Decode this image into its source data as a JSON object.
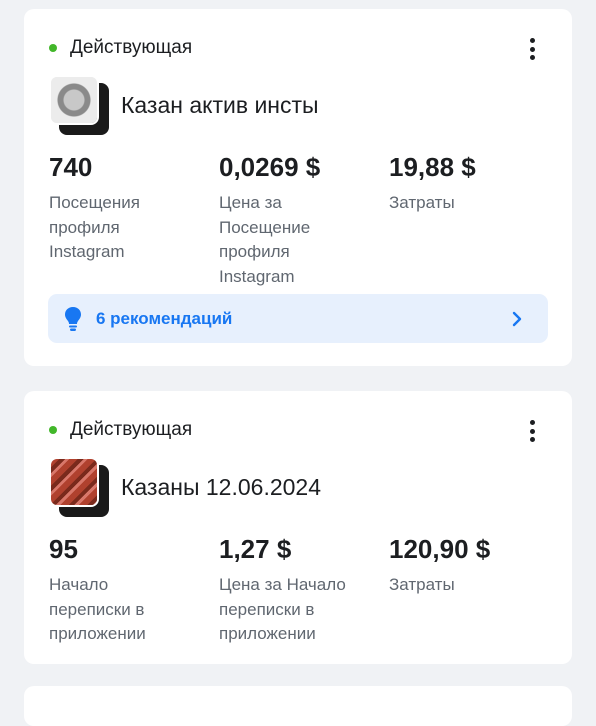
{
  "campaigns": [
    {
      "status": "Действующая",
      "status_color": "#42b72a",
      "thumbnail_icon": "campaign-image-kazan",
      "name": "Казан актив инсты",
      "metrics": [
        {
          "value": "740",
          "label": "Посещения профиля Instagram"
        },
        {
          "value": "0,0269 $",
          "label": "Цена за Посещение профиля Instagram"
        },
        {
          "value": "19,88 $",
          "label": "Затраты"
        }
      ],
      "recommendations": {
        "label": "6 рекомендаций",
        "icon": "lightbulb-icon",
        "accent": "#1877f2"
      }
    },
    {
      "status": "Действующая",
      "status_color": "#42b72a",
      "thumbnail_icon": "campaign-image-meat",
      "name": "Казаны 12.06.2024",
      "metrics": [
        {
          "value": "95",
          "label": "Начало переписки в приложении"
        },
        {
          "value": "1,27 $",
          "label": "Цена за Начало переписки в приложении"
        },
        {
          "value": "120,90 $",
          "label": "Затраты"
        }
      ]
    }
  ]
}
